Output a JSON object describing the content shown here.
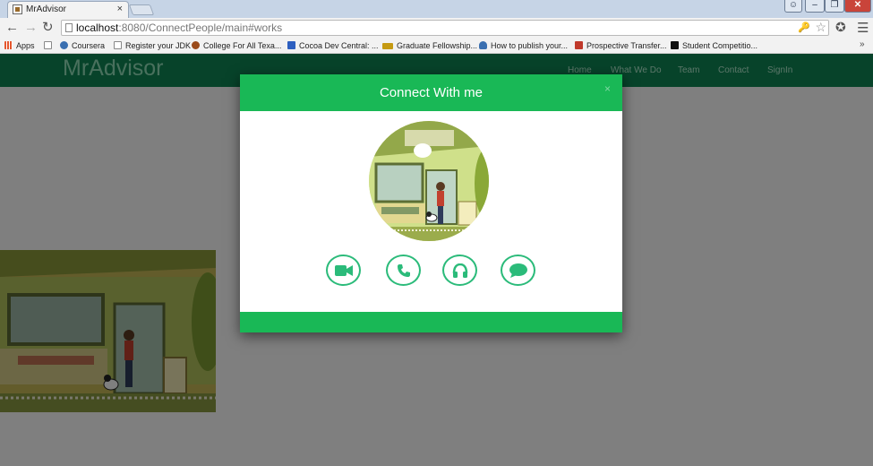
{
  "browser": {
    "tab_title": "MrAdvisor",
    "tab_close": "×",
    "url_host": "localhost",
    "url_path": ":8080/ConnectPeople/main#works",
    "bookmarks": [
      {
        "label": "Apps",
        "icon": "apps-grid-icon",
        "color": "#e4572e"
      },
      {
        "label": "Coursera",
        "icon": "coursera-icon",
        "color": "#3a6fb0"
      },
      {
        "label": "Register your JDK",
        "icon": "page-icon",
        "color": "#ffffff"
      },
      {
        "label": "College For All Texa...",
        "icon": "star-logo-icon",
        "color": "#9a4a1a"
      },
      {
        "label": "Cocoa Dev Central: ...",
        "icon": "cube-icon",
        "color": "#2d5fc0"
      },
      {
        "label": "Graduate Fellowship...",
        "icon": "nsf-icon",
        "color": "#c59a12"
      },
      {
        "label": "How to publish your...",
        "icon": "wikihow-icon",
        "color": "#3a6fb0"
      },
      {
        "label": "Prospective Transfer...",
        "icon": "utd-icon",
        "color": "#c0392b"
      },
      {
        "label": "Student Competitio...",
        "icon": "black-square-icon",
        "color": "#111111"
      }
    ],
    "more": "»"
  },
  "site": {
    "brand": "MrAdvisor",
    "nav": [
      "Home",
      "What We Do",
      "Team",
      "Contact",
      "SignIn"
    ],
    "accent": "#0d7a4e"
  },
  "modal": {
    "title": "Connect With me",
    "close": "×",
    "header_color": "#19b856",
    "actions": [
      {
        "name": "video-call",
        "icon": "video-camera-icon"
      },
      {
        "name": "voice-call",
        "icon": "phone-icon"
      },
      {
        "name": "audio",
        "icon": "headphones-icon"
      },
      {
        "name": "chat",
        "icon": "chat-bubble-icon"
      }
    ]
  }
}
